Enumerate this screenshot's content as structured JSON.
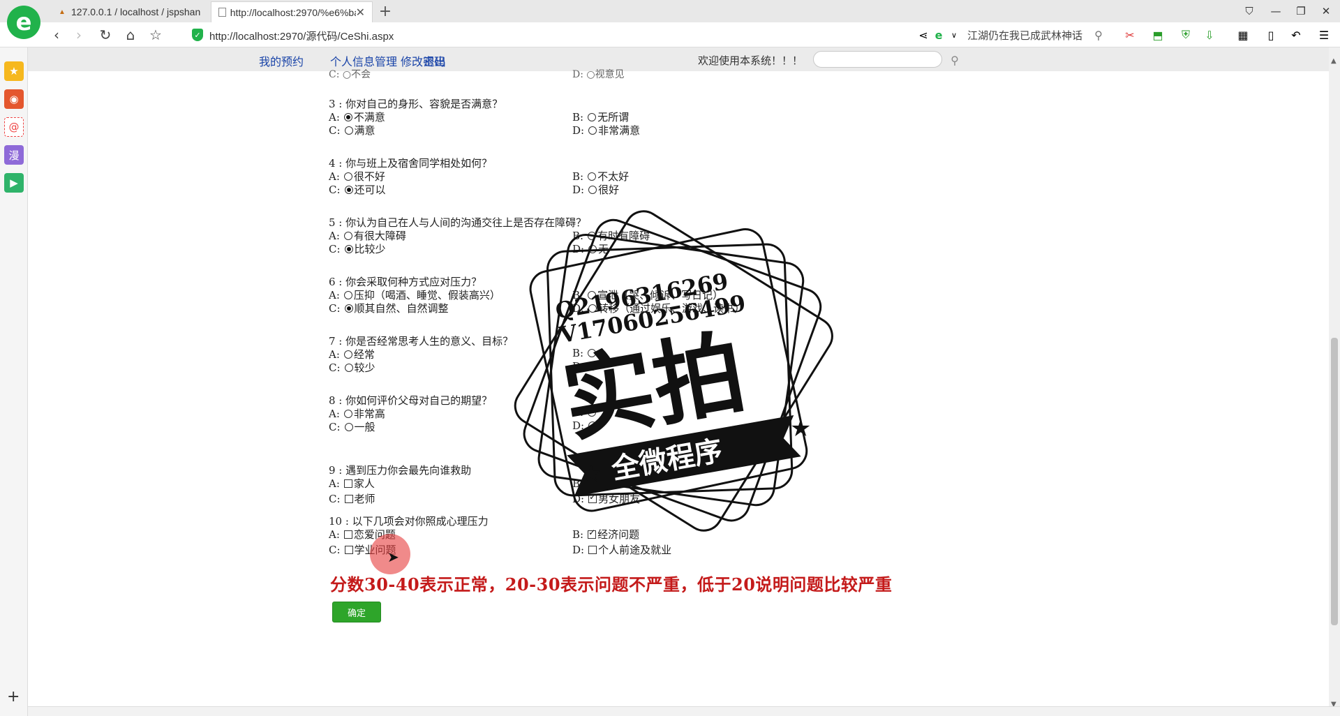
{
  "browser": {
    "logo_letter": "e",
    "tabs": [
      {
        "label": "127.0.0.1 / localhost / jspshan",
        "favicon": "PMA"
      },
      {
        "label": "http://localhost:2970/%e6%ba",
        "favicon": "doc"
      }
    ],
    "url": "http://localhost:2970/源代码/CeShi.aspx",
    "search_hint": "江湖仍在我已成武林神话"
  },
  "header": {
    "links": [
      "我的预约",
      "个人信息管理",
      "修改密码",
      "退出"
    ],
    "welcome": "欢迎使用本系统！！！"
  },
  "questions": [
    {
      "title": "3 : 你对自己的身形、容貌是否满意？",
      "type": "radio",
      "options": [
        {
          "letter": "A:",
          "text": "不满意",
          "checked": true
        },
        {
          "letter": "B:",
          "text": "无所谓",
          "checked": false
        },
        {
          "letter": "C:",
          "text": "满意",
          "checked": false
        },
        {
          "letter": "D:",
          "text": "非常满意",
          "checked": false
        }
      ]
    },
    {
      "title": "4 : 你与班上及宿舍同学相处如何？",
      "type": "radio",
      "options": [
        {
          "letter": "A:",
          "text": "很不好",
          "checked": false
        },
        {
          "letter": "B:",
          "text": "不太好",
          "checked": false
        },
        {
          "letter": "C:",
          "text": "还可以",
          "checked": true
        },
        {
          "letter": "D:",
          "text": "很好",
          "checked": false
        }
      ]
    },
    {
      "title": "5 : 你认为自己在人与人间的沟通交往上是否存在障碍？",
      "type": "radio",
      "options": [
        {
          "letter": "A:",
          "text": "有很大障碍",
          "checked": false
        },
        {
          "letter": "B:",
          "text": "有时有障碍",
          "checked": false
        },
        {
          "letter": "C:",
          "text": "比较少",
          "checked": true
        },
        {
          "letter": "D:",
          "text": "无",
          "checked": false
        }
      ]
    },
    {
      "title": "6 : 你会采取何种方式应对压力？",
      "type": "radio",
      "options": [
        {
          "letter": "A:",
          "text": "压抑（喝酒、睡觉、假装高兴）",
          "checked": false
        },
        {
          "letter": "B:",
          "text": "宣泄（哭、倾诉、写日记）",
          "checked": false
        },
        {
          "letter": "C:",
          "text": "顺其自然、自然调整",
          "checked": true
        },
        {
          "letter": "D:",
          "text": "转移（通过娱乐、游戏、读书）",
          "checked": false
        }
      ]
    },
    {
      "title": "7 : 你是否经常思考人生的意义、目标？",
      "type": "radio",
      "options": [
        {
          "letter": "A:",
          "text": "经常",
          "checked": false
        },
        {
          "letter": "B:",
          "text": "",
          "checked": false
        },
        {
          "letter": "C:",
          "text": "较少",
          "checked": false
        },
        {
          "letter": "D:",
          "text": "",
          "checked": false
        }
      ]
    },
    {
      "title": "8 : 你如何评价父母对自己的期望？",
      "type": "radio",
      "options": [
        {
          "letter": "A:",
          "text": "非常高",
          "checked": false
        },
        {
          "letter": "B:",
          "text": "",
          "checked": false
        },
        {
          "letter": "C:",
          "text": "一般",
          "checked": false
        },
        {
          "letter": "D:",
          "text": "",
          "checked": false
        }
      ]
    },
    {
      "title": "9 : 遇到压力你会最先向谁救助",
      "type": "checkbox",
      "options": [
        {
          "letter": "A:",
          "text": "家人",
          "checked": false
        },
        {
          "letter": "B:",
          "text": "朋友",
          "checked": false
        },
        {
          "letter": "C:",
          "text": "老师",
          "checked": false
        },
        {
          "letter": "D:",
          "text": "男女朋友",
          "checked": true
        }
      ]
    },
    {
      "title": "10 : 以下几项会对你照成心理压力",
      "type": "checkbox",
      "options": [
        {
          "letter": "A:",
          "text": "恋爱问题",
          "checked": false
        },
        {
          "letter": "B:",
          "text": "经济问题",
          "checked": true
        },
        {
          "letter": "C:",
          "text": "学业问题",
          "checked": false
        },
        {
          "letter": "D:",
          "text": "个人前途及就业",
          "checked": false
        }
      ]
    }
  ],
  "score_note": "分数30-40表示正常，20-30表示问题不严重，低于20说明问题比较严重",
  "confirm_label": "确定",
  "watermark": {
    "contact_q": "Q2196316269",
    "contact_v": "V17060256499",
    "title": "实拍",
    "ribbon": "全微程序"
  },
  "colors": {
    "accent_green": "#2ea52a",
    "link_blue": "#1a44a8",
    "note_red": "#c41a1a"
  }
}
